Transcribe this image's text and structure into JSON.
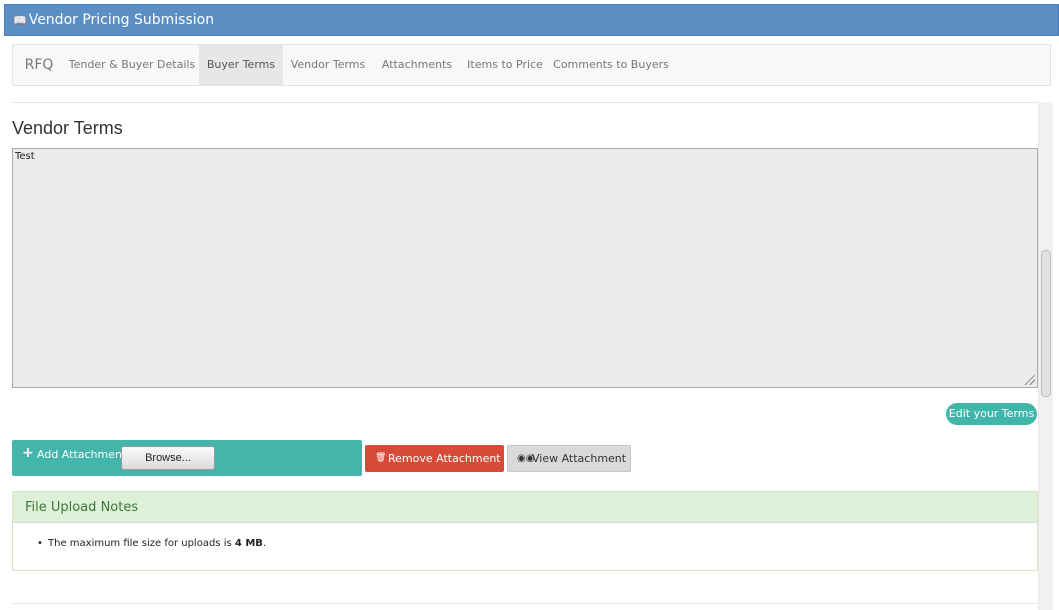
{
  "window": {
    "title": "Vendor Pricing Submission",
    "icon": "book-icon"
  },
  "nav": {
    "brand": "RFQ",
    "items": [
      {
        "label": "Tender & Buyer Details"
      },
      {
        "label": "Buyer Terms",
        "active": true
      },
      {
        "label": "Vendor Terms"
      },
      {
        "label": "Attachments"
      },
      {
        "label": "Items to Price"
      },
      {
        "label": "Comments to Buyers"
      }
    ]
  },
  "main": {
    "heading": "Vendor Terms",
    "terms_value": "Test",
    "edit_label": "Edit your Terms"
  },
  "attachments": {
    "add_label": "Add Attachment",
    "browse_label": "Browse...",
    "remove_label": "Remove Attachment",
    "view_label": "View Attachment"
  },
  "notes": {
    "title": "File Upload Notes",
    "item_prefix": "The maximum file size for uploads is ",
    "item_bold": "4 MB",
    "item_suffix": "."
  },
  "colors": {
    "titlebar": "#5b8fc3",
    "accent": "#44b5ab",
    "danger": "#d84a38",
    "notes_bg": "#dff0d8"
  }
}
